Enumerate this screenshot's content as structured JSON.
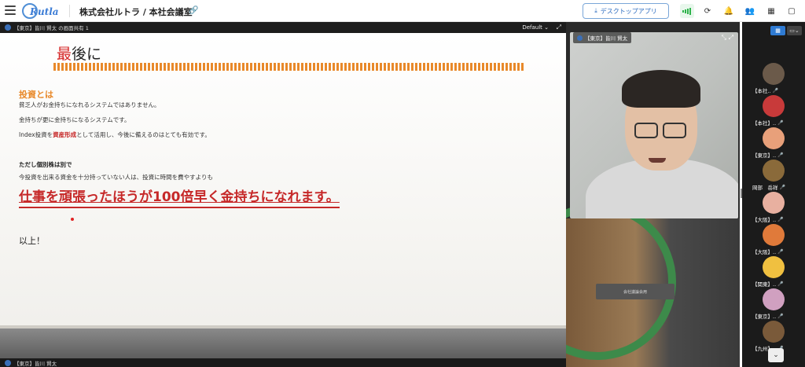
{
  "app": {
    "title": "株式会社ルトラ / 本社会議室",
    "logo_text": "Rutla"
  },
  "toolbar": {
    "download_label": "デスクトップアプリ"
  },
  "share": {
    "header_label": "【東京】皆川 賢太 の画面共有 1",
    "view_mode": "Default",
    "footer_label": "【東京】皆川 賢太"
  },
  "slide": {
    "title_first": "最",
    "title_rest": "後に",
    "heading": "投資とは",
    "line1": "貧乏人がお金持ちになれるシステムではありません。",
    "line2": "金持ちが更に金持ちになるシステムです。",
    "line3_pre": "Index投資を",
    "line3_hl": "資産形成",
    "line3_post": "として活用し、今後に備えるのはとても有効です。",
    "bold_line": "ただし個別株は別で",
    "line4": "今投資を出来る資金を十分持っていない人は、投資に時間を費やすよりも",
    "big_pre": "仕事を頑張ったほうが",
    "big_hl": "100倍",
    "big_post": "早く金持ちになれます。",
    "closing": "以上！"
  },
  "camera": {
    "name": "【東京】皆川 賢太"
  },
  "map": {
    "room_label": "会社議論会用"
  },
  "participants": [
    {
      "name": "【本社..",
      "color": "#6b5a4a"
    },
    {
      "name": "【本社】..",
      "color": "#c83a3a"
    },
    {
      "name": "【東京】..",
      "color": "#e8a07a"
    },
    {
      "name": "岡部　岳祥",
      "color": "#8a6a3a"
    },
    {
      "name": "【大阪】..",
      "color": "#e8b0a0"
    },
    {
      "name": "【大阪】..",
      "color": "#e07a3a"
    },
    {
      "name": "【関東】..",
      "color": "#f0c040"
    },
    {
      "name": "【東京】..",
      "color": "#d0a0c0"
    },
    {
      "name": "【九州】..",
      "color": "#7a5a3a"
    }
  ]
}
